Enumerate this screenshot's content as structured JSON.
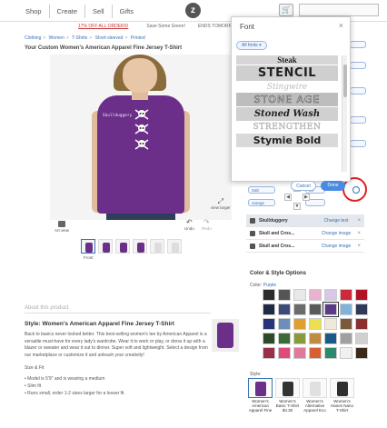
{
  "nav": {
    "links": [
      "Shop",
      "Create",
      "Sell",
      "Gifts"
    ],
    "logo": "z"
  },
  "promo": {
    "offer": "17% OFF ALL ORDERS!",
    "save": "Save Some Green!",
    "ends": "ENDS TOMORROW"
  },
  "breadcrumb": [
    "Clothing",
    "Women",
    "T-Shirts",
    "Short-sleeved",
    "Printed"
  ],
  "product": {
    "title": "Your Custom Women's American Apparel Fine Jersey T-Shirt",
    "design_text": "Skullduggery",
    "art_view": "Art view",
    "view_larger": "view larger",
    "undo": "Undo",
    "redo": "Redo",
    "front_label": "Front"
  },
  "about": {
    "header": "About this product",
    "style_title": "Style: Women's American Apparel Fine Jersey T-Shirt",
    "description": "Back to basics never looked better. This best-selling women's tee by American Apparel is a versatile must-have for every lady's wardrobe. Wear it to work or play, or dress it up with a blazer or sweater and wear it out to dinner. Super soft and lightweight. Select a design from our marketplace or customize it and unleash your creativity!",
    "size_fit": "Size & Fit",
    "bullets": [
      "Model is 5'9\" and is wearing a medium",
      "Slim fit",
      "Runs small, order 1-2 sizes larger for a looser fit"
    ]
  },
  "font_modal": {
    "title": "Font",
    "filter": "All fonts",
    "fonts": [
      "Steak",
      "STENCIL",
      "Stingwire",
      "STONE AGE",
      "Stoned Wash",
      "STRENGTHEN",
      "Stymie Bold"
    ],
    "cancel": "Cancel",
    "done": "Done"
  },
  "toolbar": {
    "font_field": "Salt",
    "size_field": "36",
    "color_field": "orange"
  },
  "layers": [
    {
      "name": "Skullduggery",
      "action": "Change text",
      "icon": "text-icon",
      "selected": true
    },
    {
      "name": "Skull and Cros...",
      "action": "Change image",
      "icon": "image-icon",
      "selected": false
    },
    {
      "name": "Skull and Cros...",
      "action": "Change image",
      "icon": "image-icon",
      "selected": false
    }
  ],
  "color_options": {
    "title": "Color & Style Options",
    "label": "Color:",
    "selected": "Purple",
    "swatches": [
      "#2b2b2b",
      "#555555",
      "#e8e8e8",
      "#e9b3cf",
      "#d8c7e8",
      "#cc2a3a",
      "#b01424",
      "#1f2b46",
      "#3b4a7a",
      "#6b6b6b",
      "#5a5a5a",
      "#5a3b8a",
      "#7fb3d9",
      "#2f3a5a",
      "#283478",
      "#6b8fb8",
      "#e0a030",
      "#ece050",
      "#f0e8d8",
      "#7a5a3a",
      "#8b2f2f",
      "#2a4a2a",
      "#3a6a3a",
      "#8a9a3a",
      "#c08a40",
      "#1a5a8a",
      "#a0a0a0",
      "#d0d0d0",
      "#9a2f4a",
      "#e04a7a",
      "#e07a9a",
      "#d86030",
      "#2a8a6a",
      "#f0f0f0",
      "#3a2a1a"
    ],
    "selected_index": 11,
    "style_label": "Style:",
    "styles": [
      {
        "name": "Women's American Apparel Fine",
        "color": "#6b2f8a"
      },
      {
        "name": "Women's Basic T-Shirt $4.30",
        "color": "#333333"
      },
      {
        "name": "Women's Alternative Apparel Eco",
        "color": "#e0e0e0"
      },
      {
        "name": "Women's Hanes Nano T-Shirt",
        "color": "#2f2f2f"
      }
    ]
  }
}
